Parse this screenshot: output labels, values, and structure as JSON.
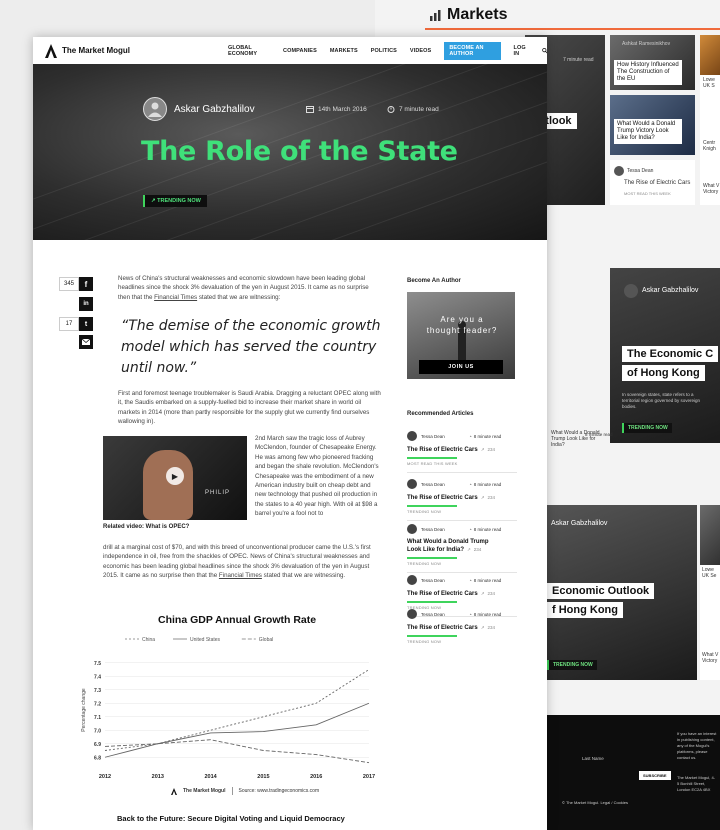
{
  "back_page": {
    "markets_title": "Markets",
    "accent": "#f06a3b",
    "tiles": {
      "read_time": "7 minute read",
      "card1": {
        "author": "Ashkat Ramesinikhov",
        "title": "How History Influenced The Construction of the EU"
      },
      "card2": {
        "title": "What Would a Donald Trump Victory Look Like for India?"
      },
      "card3": {
        "author": "Tessa Dean",
        "title": "The Rise of Electric Cars",
        "tag": "MOST READ THIS WEEK"
      },
      "card_edge1": "Lowe UK S",
      "card_edge2": "Centr Knigh",
      "card_edge3": "What V Victory",
      "outlook_label": "Outlook",
      "big_author": "Askar Gabzhalilov",
      "big_title_line1": "The Economic C",
      "big_title_line2": "of Hong Kong",
      "big_tag": "TRENDING NOW",
      "big_text": "In sovereign states, state refers to a territorial region governed by sovereign bodies.",
      "mini1_title": "What Would a Donald Trump Look Like for India?",
      "mini1_time": "8 minute read",
      "bottom_author": "Askar Gabzhalilov",
      "bottom_title_line1": "Economic Outlook",
      "bottom_title_line2": "f Hong Kong",
      "bottom_tag": "TRENDING NOW",
      "edge_bottom1": "Lowe UK Se",
      "edge_bottom2": "What V Victory",
      "footer_text": "If you have an interest in publishing content, any of the Mogul's platforms, please contact us.",
      "subscribe": "SUBSCRIBE",
      "last_name": "Last Name",
      "copyright": "© The Market Mogul. Legal / Cookies",
      "address": "The Market Mogul, 4-5 Bonhill Street, London EC2A 4BX"
    }
  },
  "nav": {
    "brand": "The Market Mogul",
    "items": [
      "GLOBAL ECONOMY",
      "COMPANIES",
      "MARKETS",
      "POLITICS",
      "VIDEOS"
    ],
    "cta": "BECOME AN AUTHOR",
    "login": "LOG IN"
  },
  "hero": {
    "author": "Askar Gabzhalilov",
    "date": "14th March 2016",
    "read_time": "7 minute read",
    "title": "The Role of the State",
    "tag": "TRENDING NOW",
    "title_color": "#3fe07a"
  },
  "share": {
    "count_fb": "345",
    "count_tw": "17"
  },
  "article": {
    "para1_a": "News of China's structural weaknesses and economic slowdown have been leading global headlines since the shock 3% devaluation of the yen in August 2015. It came as no surprise then that the ",
    "para1_link": "Financial Times",
    "para1_b": " stated that we are witnessing:",
    "quote": "“The demise of the economic growth model which has served the country until now.”",
    "para2": "First and foremost teenage troublemaker is Saudi Arabia. Dragging a reluctant OPEC along with it, the Saudis embarked on a supply-fuelled bid to increase their market share in world oil markets in 2014 (more than partly responsible for the supply glut we currently find ourselves wallowing in).",
    "para3": "2nd March saw the tragic loss of Aubrey McClendon, founder of Chesapeake Energy. He was among few who pioneered fracking and began the shale revolution. McClendon's Chesapeake was the embodiment of a new American industry built on cheap debt and new technology that pushed oil production in the states to a 40 year high. With oil at $98 a barrel you're a fool not to",
    "para4_a": "drill at a marginal cost of $70, and with this breed of unconventional producer came the U.S.'s first independence in oil, free from the shackles of OPEC. News of China's structural weaknesses and economic has been leading global headlines since the shock 3% devaluation of the yen in August 2015. It came as no surprise then that the ",
    "para4_link": "Financial Times",
    "para4_b": " stated that we are witnessing.",
    "video_caption": "Related video: What is OPEC?",
    "video_brand": "PHILIP",
    "next_article": "Back to the Future: Secure Digital Voting and Liquid Democracy"
  },
  "sidebar": {
    "become_author": "Become An Author",
    "promo_text": "Are you a thought leader?",
    "join": "JOIN US",
    "recommended": "Recommended Articles",
    "articles": [
      {
        "author": "Tessa Dean",
        "time": "8 minute read",
        "title": "The Rise of Electric Cars",
        "views": "234",
        "tag": "MOST READ THIS WEEK"
      },
      {
        "author": "Tessa Dean",
        "time": "8 minute read",
        "title": "The Rise of Electric Cars",
        "views": "234",
        "tag": "TRENDING NOW"
      },
      {
        "author": "Tessa Dean",
        "time": "8 minute read",
        "title": "What Would a Donald Trump Look Like for India?",
        "views": "234",
        "tag": "TRENDING NOW"
      },
      {
        "author": "Tessa Dean",
        "time": "8 minute read",
        "title": "The Rise of Electric Cars",
        "views": "234",
        "tag": "TRENDING NOW"
      },
      {
        "author": "Tessa Dean",
        "time": "8 minute read",
        "title": "The Rise of Electric Cars",
        "views": "234",
        "tag": "TRENDING NOW"
      }
    ]
  },
  "chart_data": {
    "type": "line",
    "title": "China GDP Annual Growth Rate",
    "ylabel": "Percentage change",
    "xlabel": "",
    "x": [
      2012,
      2013,
      2014,
      2015,
      2016,
      2017
    ],
    "ylim": [
      6.75,
      7.55
    ],
    "yticks": [
      6.8,
      6.9,
      7.0,
      7.1,
      7.2,
      7.3,
      7.4,
      7.5
    ],
    "legend_position": "top",
    "grid": true,
    "series": [
      {
        "name": "China",
        "dash": "2,2",
        "values": [
          6.85,
          6.9,
          7.0,
          7.1,
          7.2,
          7.45
        ]
      },
      {
        "name": "United States",
        "dash": "",
        "values": [
          6.8,
          6.9,
          6.98,
          6.99,
          7.04,
          7.2
        ]
      },
      {
        "name": "Global",
        "dash": "4,2",
        "values": [
          6.88,
          6.9,
          6.93,
          6.85,
          6.82,
          6.76
        ]
      }
    ],
    "source_brand": "The Market Mogul",
    "source": "Source: www.tradingeconomics.com"
  }
}
